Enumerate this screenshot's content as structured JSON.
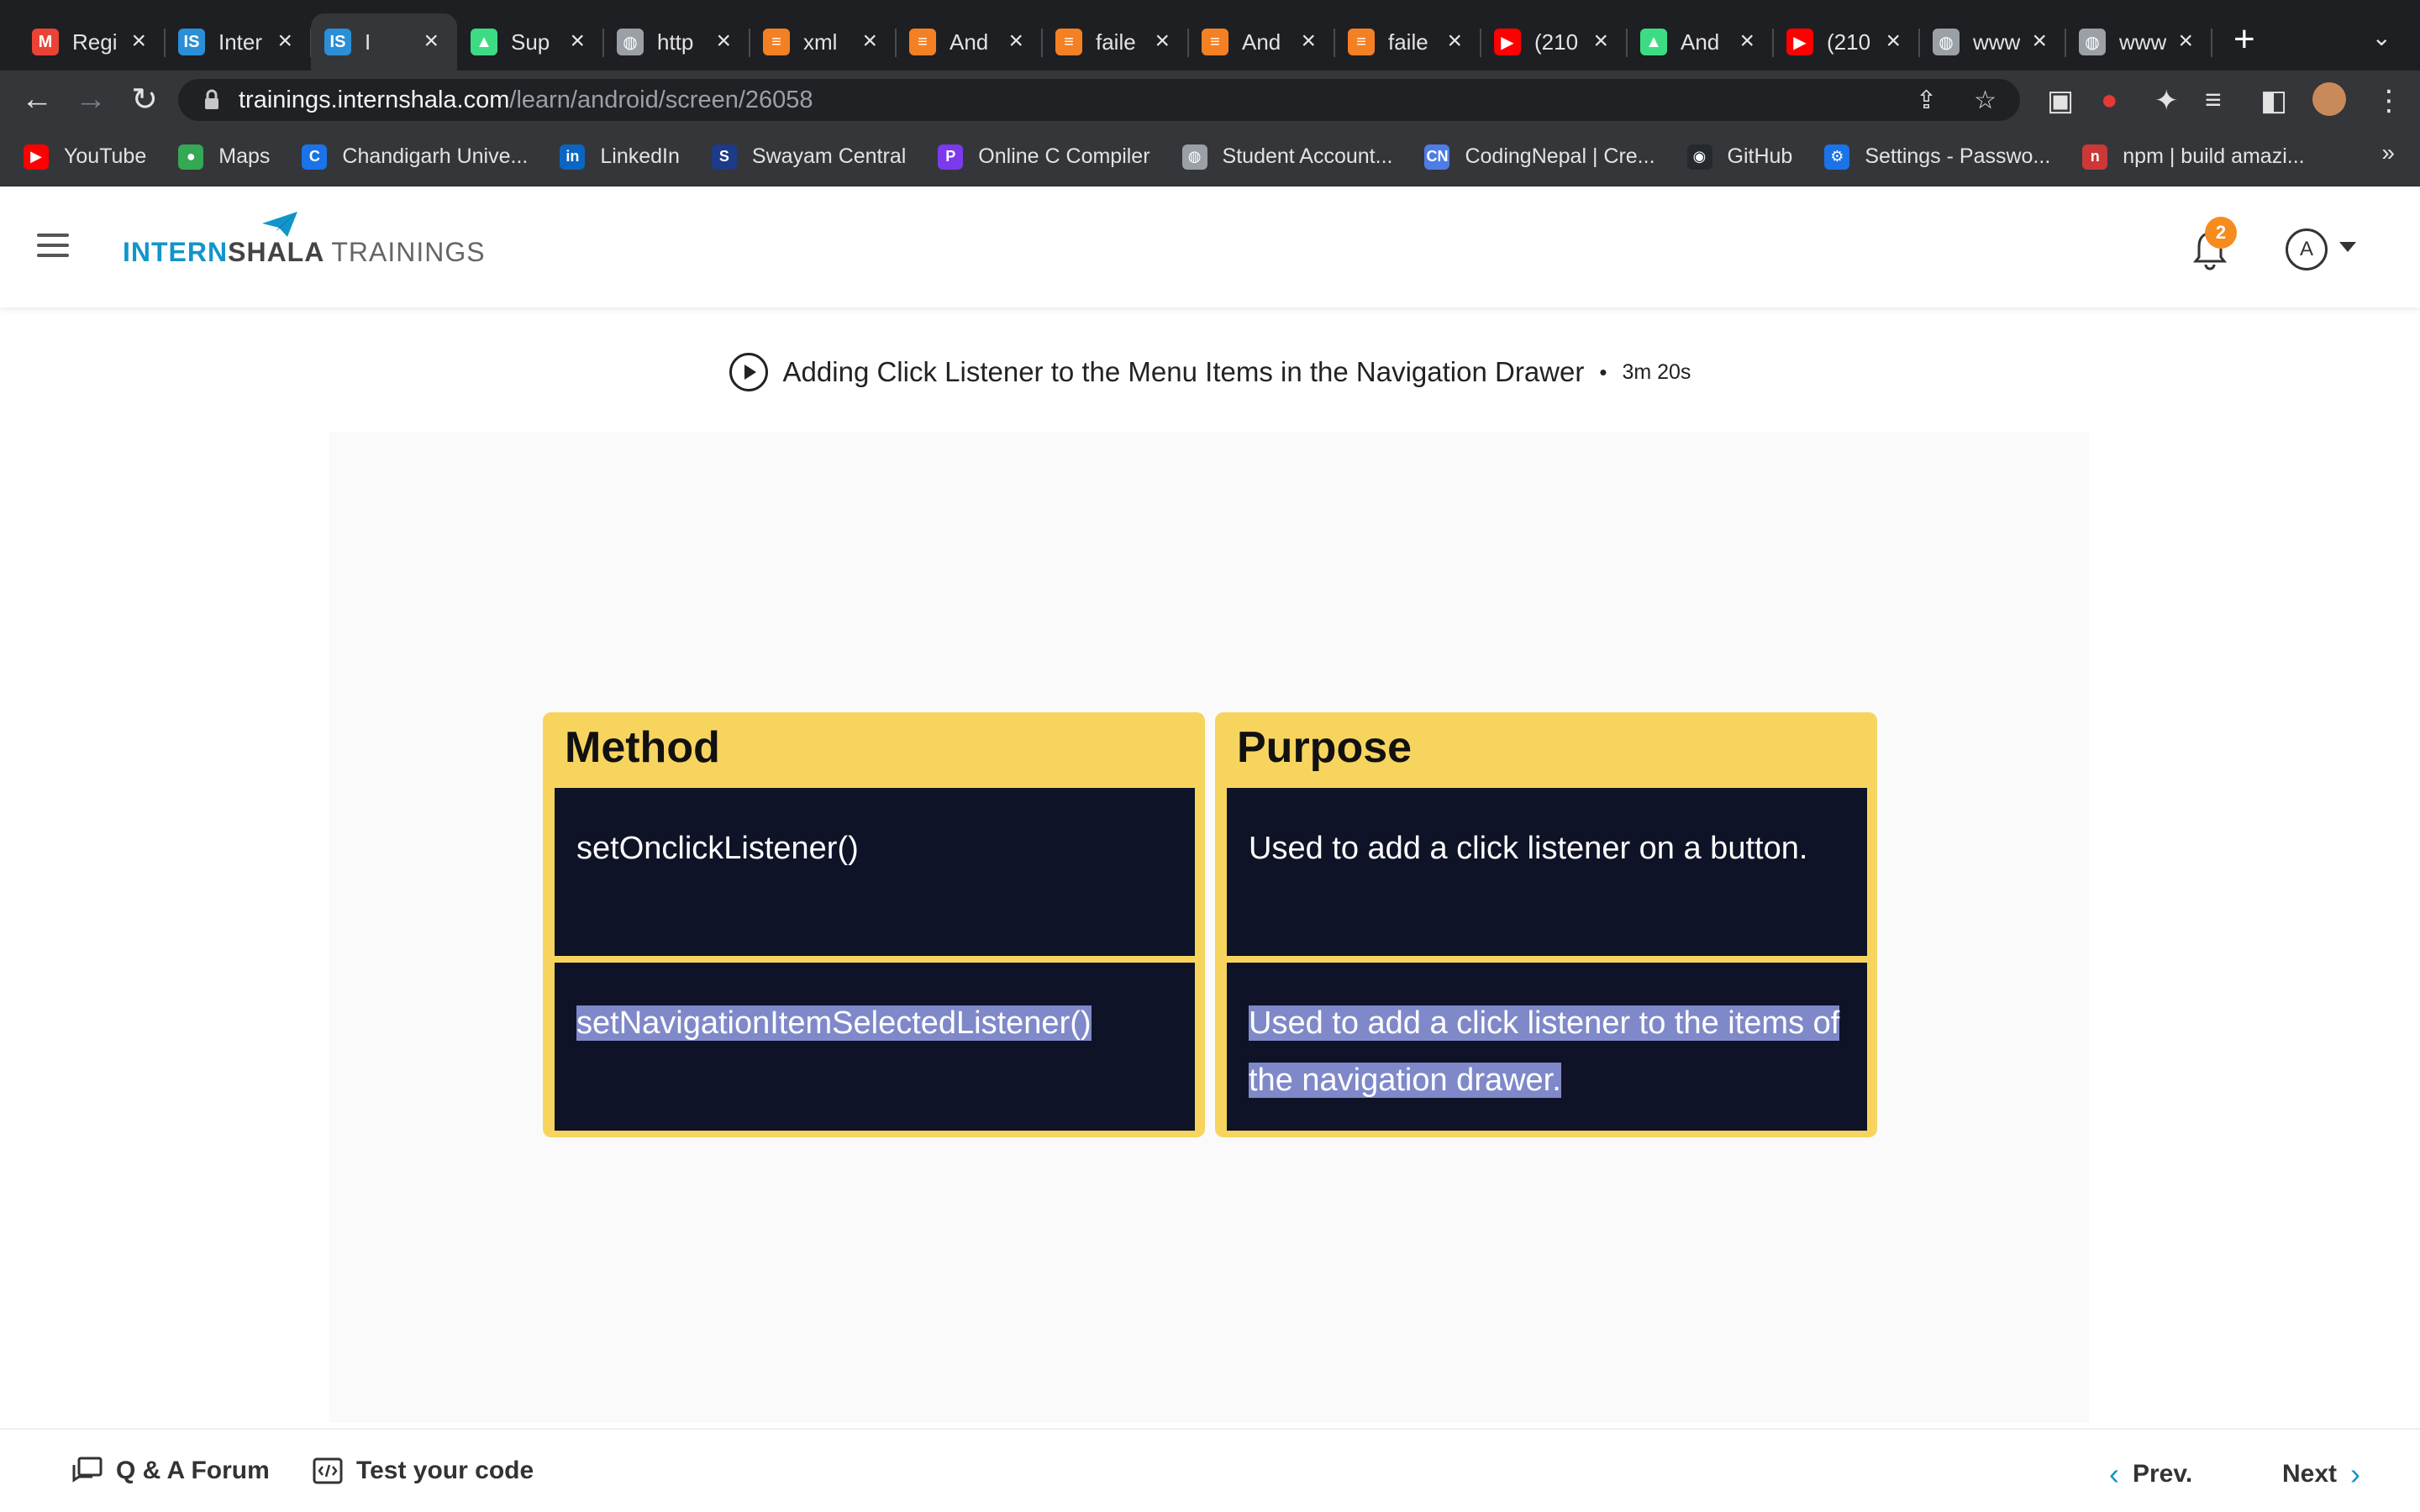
{
  "browser": {
    "tabs": [
      {
        "title": "Regi",
        "favicon": "gmail-icon",
        "color": "#ea4335",
        "glyph": "M"
      },
      {
        "title": "Inter",
        "favicon": "internshala-icon",
        "color": "#2a8fd6",
        "glyph": "IS"
      },
      {
        "title": "I",
        "favicon": "internshala-icon",
        "color": "#2a8fd6",
        "glyph": "IS",
        "active": true
      },
      {
        "title": "Sup",
        "favicon": "android-icon",
        "color": "#3ddc84",
        "glyph": "▲"
      },
      {
        "title": "http",
        "favicon": "globe-icon",
        "color": "#9aa0a6",
        "glyph": "◍"
      },
      {
        "title": "xml",
        "favicon": "stackoverflow-icon",
        "color": "#f48024",
        "glyph": "≡"
      },
      {
        "title": "And",
        "favicon": "stackoverflow-icon",
        "color": "#f48024",
        "glyph": "≡"
      },
      {
        "title": "faile",
        "favicon": "stackoverflow-icon",
        "color": "#f48024",
        "glyph": "≡"
      },
      {
        "title": "And",
        "favicon": "stackoverflow-icon",
        "color": "#f48024",
        "glyph": "≡"
      },
      {
        "title": "faile",
        "favicon": "stackoverflow-icon",
        "color": "#f48024",
        "glyph": "≡"
      },
      {
        "title": "(210",
        "favicon": "youtube-icon",
        "color": "#ff0000",
        "glyph": "▶"
      },
      {
        "title": "And",
        "favicon": "android-icon",
        "color": "#3ddc84",
        "glyph": "▲"
      },
      {
        "title": "(210",
        "favicon": "youtube-icon",
        "color": "#ff0000",
        "glyph": "▶"
      },
      {
        "title": "www",
        "favicon": "globe-icon",
        "color": "#9aa0a6",
        "glyph": "◍"
      },
      {
        "title": "www",
        "favicon": "globe-icon",
        "color": "#9aa0a6",
        "glyph": "◍"
      }
    ],
    "url_domain": "trainings.internshala.com",
    "url_path": "/learn/android/screen/26058",
    "bookmarks": [
      {
        "label": "YouTube",
        "icon": "youtube-icon",
        "color": "#ff0000",
        "glyph": "▶"
      },
      {
        "label": "Maps",
        "icon": "maps-icon",
        "color": "#34a853",
        "glyph": "●"
      },
      {
        "label": "Chandigarh Unive...",
        "icon": "chandigarh-icon",
        "color": "#1a73e8",
        "glyph": "C"
      },
      {
        "label": "LinkedIn",
        "icon": "linkedin-icon",
        "color": "#0a66c2",
        "glyph": "in"
      },
      {
        "label": "Swayam Central",
        "icon": "swayam-icon",
        "color": "#1e3a8a",
        "glyph": "S"
      },
      {
        "label": "Online C Compiler",
        "icon": "compiler-icon",
        "color": "#7c3aed",
        "glyph": "P"
      },
      {
        "label": "Student Account...",
        "icon": "globe-icon",
        "color": "#9aa0a6",
        "glyph": "◍"
      },
      {
        "label": "CodingNepal | Cre...",
        "icon": "codingnepal-icon",
        "color": "#4f7de6",
        "glyph": "CN"
      },
      {
        "label": "GitHub",
        "icon": "github-icon",
        "color": "#24292e",
        "glyph": "◉"
      },
      {
        "label": "Settings - Passwo...",
        "icon": "gear-icon",
        "color": "#1a73e8",
        "glyph": "⚙"
      },
      {
        "label": "npm | build amazi...",
        "icon": "npm-icon",
        "color": "#cb3837",
        "glyph": "n"
      }
    ],
    "more": "»"
  },
  "header": {
    "logo_part1": "INTERN",
    "logo_part2": "SHALA",
    "logo_part3": "TRAININGS",
    "notification_count": "2",
    "avatar_initial": "A"
  },
  "lesson": {
    "title": "Adding Click Listener to the Menu Items in the Navigation Drawer",
    "separator": "•",
    "duration": "3m 20s"
  },
  "slide": {
    "method_header": "Method",
    "purpose_header": "Purpose",
    "rows": [
      {
        "method": "setOnclickListener()",
        "purpose": "Used to add a click listener on a button."
      },
      {
        "method": "setNavigationItemSelectedListener()",
        "purpose": "Used to add a click listener to the items of the navigation drawer."
      }
    ],
    "accent_color": "#f7d45e",
    "cell_color": "#0f1327"
  },
  "footer": {
    "qa_label": "Q & A Forum",
    "test_label": "Test your code",
    "prev_label": "Prev.",
    "next_label": "Next"
  }
}
